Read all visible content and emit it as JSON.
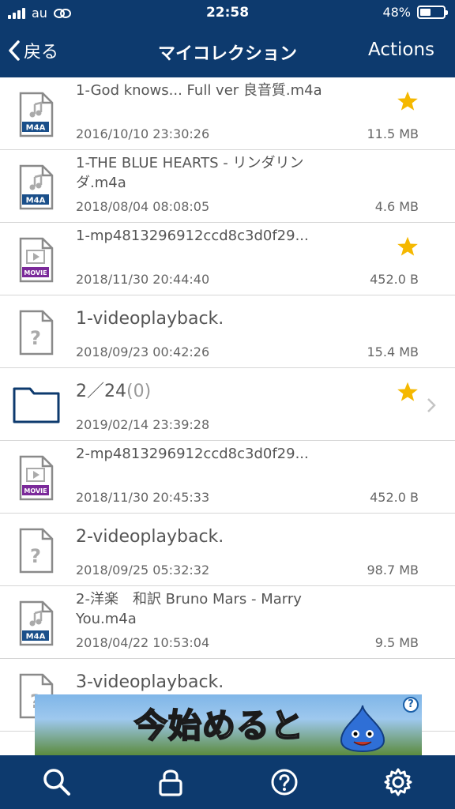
{
  "status_bar": {
    "carrier": "au",
    "time": "22:58",
    "battery_text": "48%",
    "battery_level": 0.48
  },
  "nav": {
    "back_label": "戻る",
    "title": "マイコレクション",
    "actions_label": "Actions"
  },
  "items": [
    {
      "name": "1-God knows... Full ver 良音質.m4a",
      "date": "2016/10/10 23:30:26",
      "size": "11.5 MB",
      "type": "m4a",
      "type_label": "M4A",
      "starred": true
    },
    {
      "name": "1-THE BLUE HEARTS - リンダリンダ.m4a",
      "date": "2018/08/04 08:08:05",
      "size": "4.6 MB",
      "type": "m4a",
      "type_label": "M4A",
      "starred": false
    },
    {
      "name": "1-mp4813296912ccd8c3d0f29...",
      "date": "2018/11/30 20:44:40",
      "size": "452.0 B",
      "type": "movie",
      "type_label": "MOVIE",
      "starred": true
    },
    {
      "name": "1-videoplayback.",
      "date": "2018/09/23 00:42:26",
      "size": "15.4 MB",
      "type": "unknown",
      "starred": false
    },
    {
      "name": "2／24",
      "count": "(0)",
      "date": "2019/02/14 23:39:28",
      "size": "",
      "type": "folder",
      "starred": true
    },
    {
      "name": "2-mp4813296912ccd8c3d0f29...",
      "date": "2018/11/30 20:45:33",
      "size": "452.0 B",
      "type": "movie",
      "type_label": "MOVIE",
      "starred": false
    },
    {
      "name": "2-videoplayback.",
      "date": "2018/09/25 05:32:32",
      "size": "98.7 MB",
      "type": "unknown",
      "starred": false
    },
    {
      "name": "2-洋楽　和訳 Bruno Mars - Marry You.m4a",
      "date": "2018/04/22 10:53:04",
      "size": "9.5 MB",
      "type": "m4a",
      "type_label": "M4A",
      "starred": false
    },
    {
      "name": "3-videoplayback.",
      "date": "",
      "size": "",
      "type": "unknown",
      "starred": false
    }
  ],
  "ad": {
    "text": "今始めると",
    "info_label": "?"
  },
  "tabbar": {
    "tabs": [
      {
        "icon": "search-icon"
      },
      {
        "icon": "lock-icon"
      },
      {
        "icon": "help-icon"
      },
      {
        "icon": "gear-icon"
      }
    ]
  },
  "colors": {
    "bar_background": "#0d3a6e",
    "star": "#f5b800",
    "movie_badge": "#7b2a9a",
    "m4a_badge": "#1a4f8a"
  }
}
